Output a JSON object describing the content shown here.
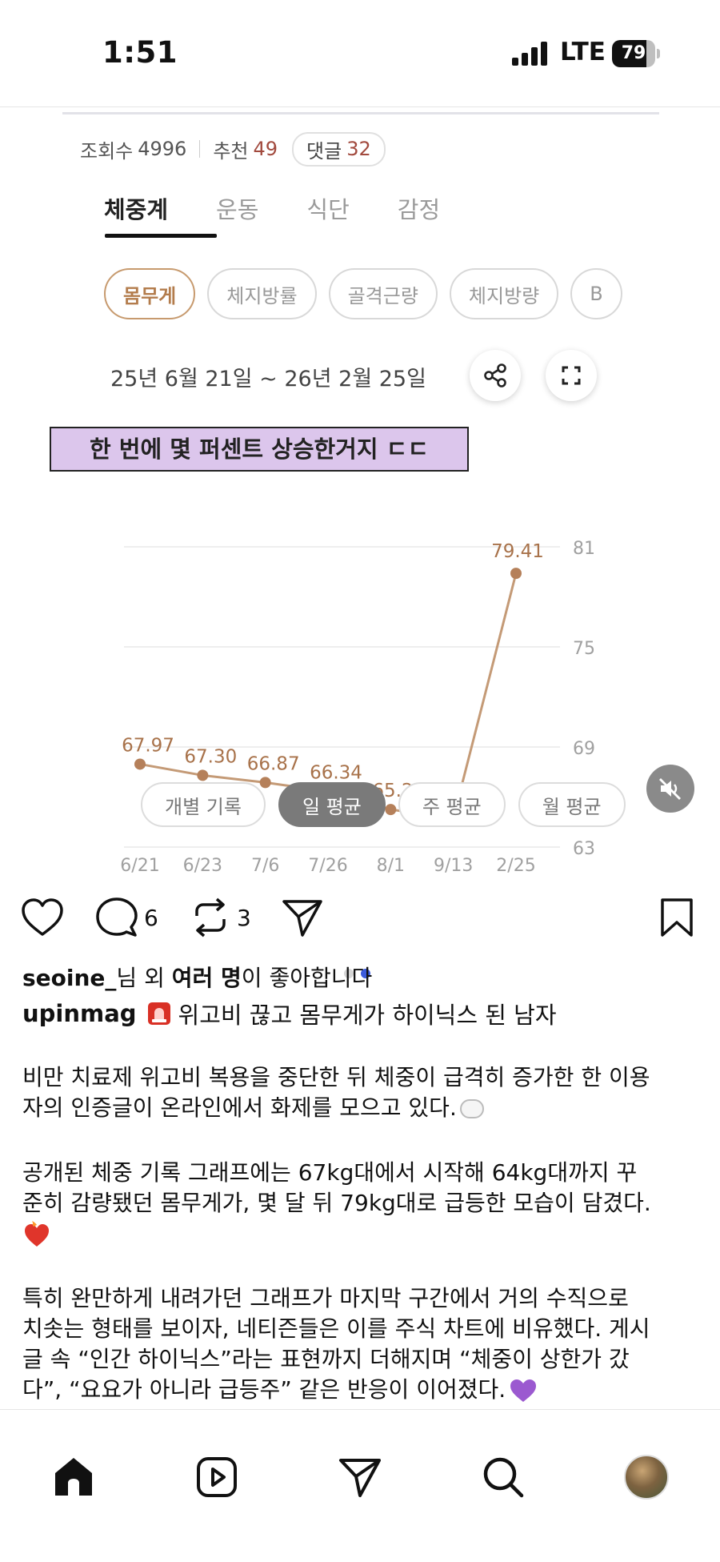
{
  "status_bar": {
    "time": "1:51",
    "network": "LTE",
    "battery": "79",
    "battery_level": 0.79
  },
  "post_image": {
    "stats": {
      "views_label": "조회수",
      "views_value": "4996",
      "likes_label": "추천",
      "likes_value": "49",
      "comments_label": "댓글",
      "comments_value": "32"
    },
    "tabs": [
      {
        "label": "체중계",
        "active": true
      },
      {
        "label": "운동",
        "active": false
      },
      {
        "label": "식단",
        "active": false
      },
      {
        "label": "감정",
        "active": false
      }
    ],
    "chips": [
      {
        "label": "몸무게",
        "active": true
      },
      {
        "label": "체지방률",
        "active": false
      },
      {
        "label": "골격근량",
        "active": false
      },
      {
        "label": "체지방량",
        "active": false
      },
      {
        "label": "B",
        "active": false
      }
    ],
    "date_range": "25년 6월 21일 ~ 26년 2월 25일",
    "caption_overlay": "한 번에 몇 퍼센트 상승한거지 ㄷㄷ",
    "avg_buttons": [
      {
        "label": "개별 기록",
        "active": false
      },
      {
        "label": "일 평균",
        "active": true
      },
      {
        "label": "주 평균",
        "active": false
      },
      {
        "label": "월 평균",
        "active": false
      }
    ],
    "carousel": {
      "count": 2,
      "active_index": 1
    }
  },
  "chart_data": {
    "type": "line",
    "categories": [
      "6/21",
      "6/23",
      "7/6",
      "7/26",
      "8/1",
      "9/13",
      "2/25"
    ],
    "values": [
      67.97,
      67.3,
      66.87,
      66.34,
      65.25,
      64.73,
      79.41
    ],
    "value_labels": [
      "67.97",
      "67.30",
      "66.87",
      "66.34",
      "65.25",
      "64.73",
      "79.41"
    ],
    "y_ticks": [
      81,
      75,
      69,
      63
    ],
    "ylim": [
      63,
      81
    ],
    "grid": true,
    "colors": {
      "line": "#c49a76",
      "point": "#b5805a",
      "label": "#a8724a",
      "grid": "#eeeeee",
      "tick": "#a0a0a0"
    }
  },
  "actions": {
    "comment_count": "6",
    "repost_count": "3"
  },
  "likes_text": {
    "user": "seoine_",
    "mid": "님 외 ",
    "others": "여러 명",
    "suffix": "이 좋아합니다"
  },
  "caption": {
    "username": "upinmag",
    "headline": "위고비 끊고 몸무게가 하이닉스 된 남자"
  },
  "body": {
    "p1_l1": "비만 치료제 위고비 복용을 중단한 뒤 체중이 급격히 증가한 한 이용",
    "p1_l2": "자의 인증글이 온라인에서 화제를 모으고 있다.",
    "p2_l1": "공개된 체중 기록 그래프에는 67kg대에서 시작해 64kg대까지 꾸",
    "p2_l2": "준히 감량됐던 몸무게가, 몇 달 뒤 79kg대로 급등한 모습이 담겼다.",
    "p3_l1": "특히 완만하게 내려가던 그래프가 마지막 구간에서 거의 수직으로",
    "p3_l2": "치솟는 형태를 보이자, 네티즌들은 이를 주식 차트에 비유했다. 게시",
    "p3_l3": "글 속 “인간 하이닉스”라는 표현까지 더해지며 “체중이 상한가 갔",
    "p3_l4": "다”, “요요가 아니라 급등주” 같은 반응이 이어졌다."
  },
  "icons": [
    "heart-icon",
    "comment-icon",
    "repost-icon",
    "send-icon",
    "bookmark-icon",
    "siren-icon",
    "share-icon",
    "fullscreen-icon",
    "mute-icon",
    "home-icon",
    "reels-icon",
    "messages-icon",
    "search-icon",
    "profile-avatar"
  ]
}
